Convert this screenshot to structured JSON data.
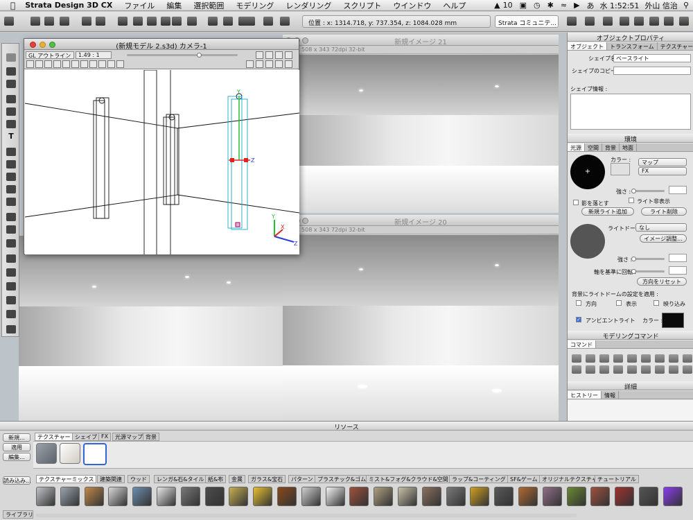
{
  "menubar": {
    "app_name": "Strata Design 3D CX",
    "items": [
      "ファイル",
      "編集",
      "選択範囲",
      "モデリング",
      "レンダリング",
      "スクリプト",
      "ウインドウ",
      "ヘルプ"
    ],
    "status": {
      "adobe": "10",
      "ime": "あ",
      "clock": "水 1:52:51",
      "user": "外山 信治"
    }
  },
  "toolbar": {
    "coords_text": "位置 : x: 1314.718, y: 737.354, z: 1084.028 mm",
    "strata_popup": "Strata コミュニテ..."
  },
  "windows": {
    "image21": {
      "title": "新規イメージ 21",
      "info": "681K  508 x 343  72dpi  32-bit"
    },
    "image20": {
      "title": "新規イメージ 20",
      "info": "681K  508 x 343  72dpi  32-bit"
    },
    "camera": {
      "title": "(新規モデル 2.s3d) カメラ-1",
      "render_mode": "GL アウトライン",
      "zoom": "1.49 : 1",
      "axes": {
        "x": "X",
        "y": "Y",
        "z": "Z"
      }
    }
  },
  "properties": {
    "header": "オブジェクトプロパティ",
    "tabs": [
      "オブジェクト",
      "トランスフォーム",
      "テクスチャー"
    ],
    "shape_name_label": "シェイプ名 :",
    "shape_name_value": "ベースライト",
    "copy_name_label": "シェイプのコピー名 :",
    "copy_name_value": "",
    "info_label": "シェイプ情報 :"
  },
  "environment": {
    "header": "環境",
    "tabs": [
      "光源",
      "空間",
      "背景",
      "地面"
    ],
    "color_label": "カラー :",
    "map_popup": "マップ",
    "fx_popup": "FX",
    "strength_label": "強さ :",
    "shadow_label": "影を落とす",
    "hide_light_label": "ライト非表示",
    "add_light_button": "新規ライト追加",
    "delete_light_button": "ライト削除",
    "dome_label": "ライトドーム :",
    "dome_popup": "なし",
    "image_adjust_button": "イメージ調整...",
    "strength2_label": "強さ :",
    "rotate_label": "軸を基準に回転 :",
    "reset_dir_button": "方向をリセット",
    "apply_dome_label": "背景にライトドームの設定を適用 :",
    "direction_label": "方向",
    "display_label": "表示",
    "reflection_label": "映り込み",
    "ambient_label": "アンビエントライト",
    "ambient_color_label": "カラー :",
    "ambient_color": "#0a0a0a",
    "sphere_color": "#050505",
    "dome_sphere_color": "#555555"
  },
  "modeling": {
    "header": "モデリングコマンド",
    "tab": "コマンド"
  },
  "details": {
    "header": "詳細",
    "tabs": [
      "ヒストリー",
      "情報"
    ]
  },
  "resources": {
    "header": "リソース",
    "side_buttons": [
      "新規...",
      "適用",
      "編集...",
      "読み込み..."
    ],
    "library_label": "ライブラリ",
    "tabs": [
      "テクスチャー",
      "シェイプ",
      "FX",
      "光源マップ",
      "背景"
    ],
    "library_tabs": [
      "テクスチャーミックス",
      "建築関連",
      "ウッド",
      "レンガ&石&タイル",
      "紙&布",
      "金属",
      "ガラス&宝石",
      "パターン",
      "プラスチック&ゴム",
      "ミスト&フォグ&クラウド&空間",
      "ラップ&コーティング",
      "SF&ゲーム",
      "オリジナルテクスチャ",
      "チュートリアル"
    ]
  },
  "texture_swatch_colors": [
    "#c0c4c8",
    "#9aa4ae",
    "#c08a4a",
    "#d8d8d8",
    "#6c8fb0",
    "#e8e8e8",
    "#777777",
    "#4c4c4c",
    "#c8b050",
    "#e8c030",
    "#8a4a1a",
    "#d0d0d0",
    "#f4f4f4",
    "#a0503c",
    "#b0a080",
    "#c8c0a8",
    "#8a7060",
    "#7a7a7a",
    "#d0a020",
    "#5a5a5a",
    "#b06a30",
    "#907088",
    "#6a8a30",
    "#a05040",
    "#a03030",
    "#555555",
    "#8a3cf0"
  ]
}
